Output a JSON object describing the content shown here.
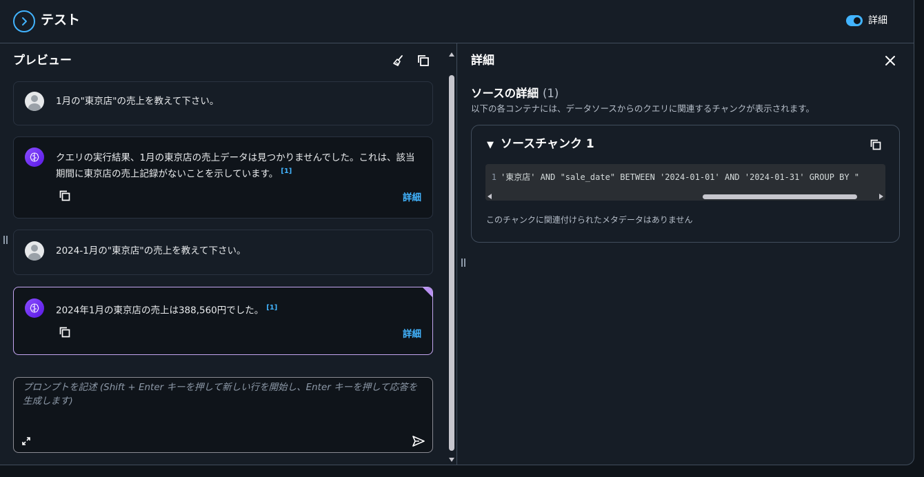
{
  "header": {
    "title": "テスト",
    "toggle_label": "詳細"
  },
  "preview": {
    "title": "プレビュー",
    "messages": [
      {
        "role": "user",
        "text": "1月の\"東京店\"の売上を教えて下さい。"
      },
      {
        "role": "ai",
        "text": " クエリの実行結果、1月の東京店の売上データは見つかりませんでした。これは、該当期間に東京店の売上記録がないことを示しています。",
        "cite": "[1]",
        "detail": "詳細"
      },
      {
        "role": "user",
        "text": "2024-1月の\"東京店\"の売上を教えて下さい。"
      },
      {
        "role": "ai",
        "text": " 2024年1月の東京店の売上は388,560円でした。",
        "cite": "[1]",
        "detail": "詳細"
      }
    ],
    "prompt_placeholder": "プロンプトを記述 (Shift + Enter キーを押して新しい行を開始し、Enter キーを押して応答を生成します)"
  },
  "details": {
    "title": "詳細",
    "source_title": "ソースの詳細",
    "source_count": "(1)",
    "source_desc": "以下の各コンテナには、データソースからのクエリに関連するチャンクが表示されます。",
    "chunk": {
      "title": "ソースチャンク 1",
      "line_number": "1",
      "code": "'東京店' AND \"sale_date\" BETWEEN '2024-01-01' AND '2024-01-31' GROUP BY \"",
      "no_metadata": "このチャンクに関連付けられたメタデータはありません"
    }
  },
  "colors": {
    "accent": "#42b4ff",
    "ai_avatar": "#7d3cf5",
    "selected_border": "#c5a6f2"
  }
}
